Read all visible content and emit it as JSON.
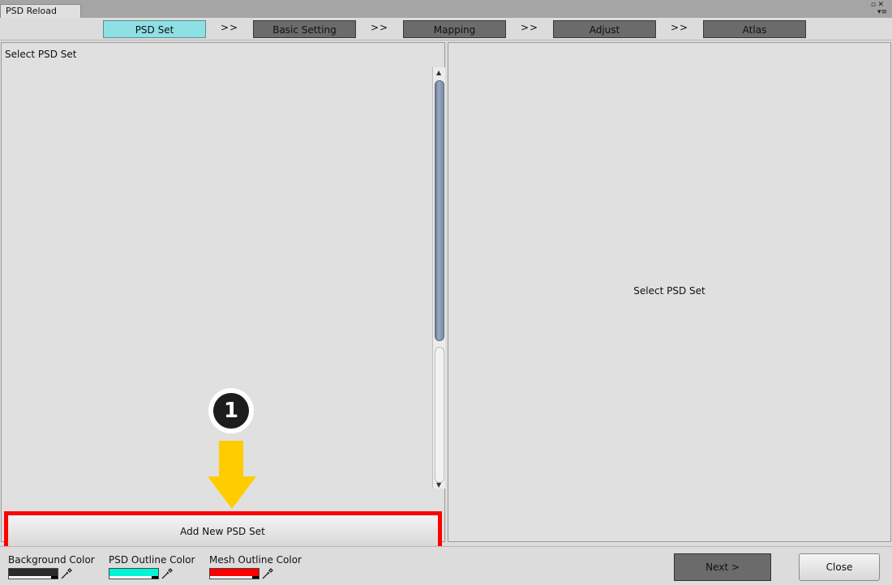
{
  "window": {
    "tab_title": "PSD Reload"
  },
  "steps": [
    {
      "label": "PSD Set",
      "active": true
    },
    {
      "label": "Basic Setting",
      "active": false
    },
    {
      "label": "Mapping",
      "active": false
    },
    {
      "label": "Adjust",
      "active": false
    },
    {
      "label": "Atlas",
      "active": false
    }
  ],
  "step_separator": ">>",
  "left_panel": {
    "title": "Select PSD Set",
    "add_button": "Add New PSD Set"
  },
  "right_panel": {
    "message": "Select PSD Set"
  },
  "annotation": {
    "badge_number": "1",
    "arrow_color": "#ffcc00",
    "highlight_color": "#ff0000"
  },
  "footer": {
    "colors": [
      {
        "label": "Background Color",
        "value": "#2b2b2b"
      },
      {
        "label": "PSD Outline Color",
        "value": "#00f5d4"
      },
      {
        "label": "Mesh Outline Color",
        "value": "#ff0000"
      }
    ],
    "next_button": "Next >",
    "close_button": "Close"
  },
  "icons": {
    "maximize": "maximize-icon",
    "close": "close-icon",
    "menu": "menu-icon",
    "eyedropper": "eyedropper-icon"
  }
}
